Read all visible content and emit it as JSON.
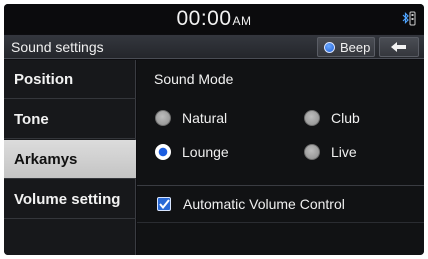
{
  "status_bar": {
    "time": "00:00",
    "ampm": "AM"
  },
  "title_bar": {
    "title": "Sound settings",
    "beep_label": "Beep"
  },
  "sidebar": {
    "items": [
      {
        "label": "Position",
        "selected": false
      },
      {
        "label": "Tone",
        "selected": false
      },
      {
        "label": "Arkamys",
        "selected": true
      },
      {
        "label": "Volume setting",
        "selected": false
      }
    ]
  },
  "main": {
    "section_title": "Sound Mode",
    "options": [
      {
        "label": "Natural",
        "checked": false
      },
      {
        "label": "Club",
        "checked": false
      },
      {
        "label": "Lounge",
        "checked": true
      },
      {
        "label": "Live",
        "checked": false
      }
    ],
    "auto_volume_label": "Automatic Volume Control",
    "auto_volume_checked": true
  },
  "colors": {
    "accent": "#1f5fd6",
    "selected_bg": "#d0d0d0"
  }
}
